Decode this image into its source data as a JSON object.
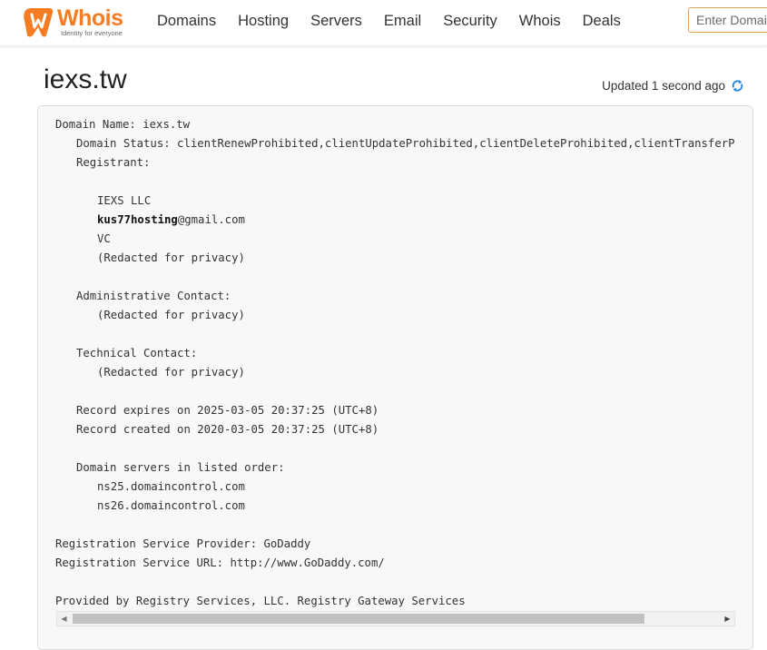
{
  "brand": {
    "name": "Whois",
    "tagline": "Identity for everyone",
    "accent": "#f57c22"
  },
  "nav": {
    "items": [
      {
        "label": "Domains"
      },
      {
        "label": "Hosting"
      },
      {
        "label": "Servers"
      },
      {
        "label": "Email"
      },
      {
        "label": "Security"
      },
      {
        "label": "Whois"
      },
      {
        "label": "Deals"
      }
    ]
  },
  "search": {
    "placeholder": "Enter Domain or IP"
  },
  "page": {
    "title": "iexs.tw",
    "updated": "Updated 1 second ago"
  },
  "record": {
    "domain_name": "Domain Name: iexs.tw",
    "domain_status": "Domain Status: clientRenewProhibited,clientUpdateProhibited,clientDeleteProhibited,clientTransferProhibited",
    "registrant_label": "Registrant:",
    "registrant_name": "IEXS LLC",
    "registrant_email_user": "kus77hosting",
    "registrant_email_domain": "@gmail.com",
    "registrant_country": "VC",
    "registrant_redacted": "(Redacted for privacy)",
    "admin_label": "Administrative Contact:",
    "admin_redacted": "(Redacted for privacy)",
    "tech_label": "Technical Contact:",
    "tech_redacted": "(Redacted for privacy)",
    "expires": "Record expires on 2025-03-05 20:37:25 (UTC+8)",
    "created": "Record created on 2020-03-05 20:37:25 (UTC+8)",
    "ns_label": "Domain servers in listed order:",
    "ns": [
      "ns25.domaincontrol.com",
      "ns26.domaincontrol.com"
    ],
    "provider": "Registration Service Provider: GoDaddy",
    "provider_url": "Registration Service URL: http://www.GoDaddy.com/",
    "provided_by": "Provided by Registry Services, LLC. Registry Gateway Services"
  },
  "scroll": {
    "left_glyph": "◀",
    "right_glyph": "▶",
    "position": 0
  }
}
